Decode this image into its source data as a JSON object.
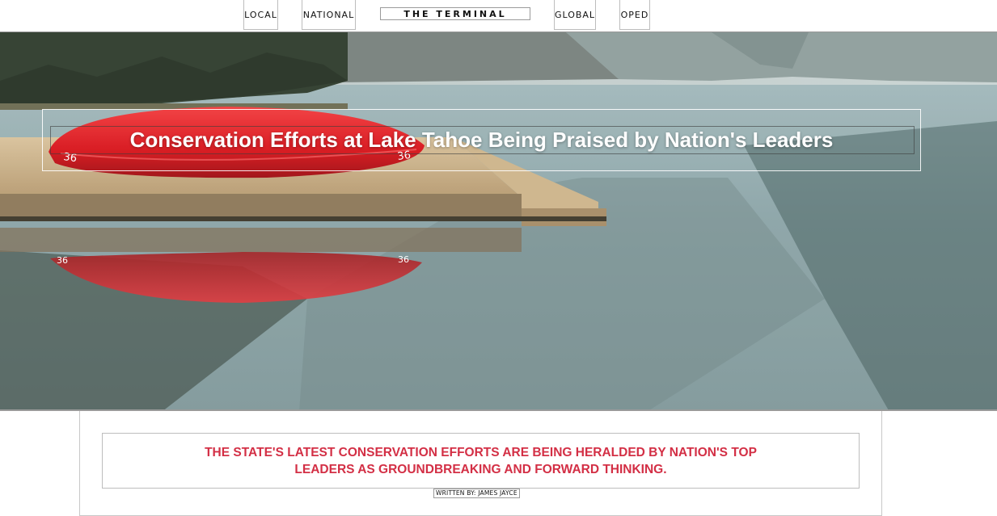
{
  "nav": {
    "items": [
      {
        "label": "LOCAL"
      },
      {
        "label": "NATIONAL"
      },
      {
        "label": "GLOBAL"
      },
      {
        "label": "OPED"
      }
    ],
    "brand": "THE TERMINAL"
  },
  "hero": {
    "title": "Conservation Efforts at Lake Tahoe Being Praised by Nation's Leaders",
    "image_description_icon": "lake-dock-canoe-photo",
    "boat_numbers": [
      "36",
      "36"
    ]
  },
  "article": {
    "subhead": "THE STATE'S LATEST CONSERVATION EFFORTS ARE BEING HERALDED BY NATION'S TOP LEADERS AS GROUNDBREAKING AND FORWARD THINKING.",
    "byline": "WRITTEN BY: JAMES JAYCE"
  },
  "colors": {
    "accent": "#d32f45",
    "canoe": "#e0141c",
    "water": "#8fa6a9"
  }
}
